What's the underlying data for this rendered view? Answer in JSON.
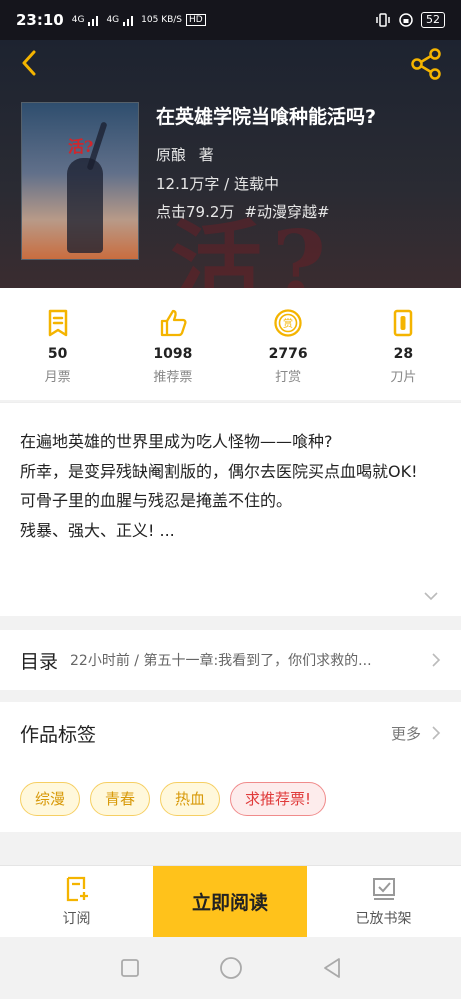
{
  "status_bar": {
    "time": "23:10",
    "signal_1": "4G",
    "signal_2": "4G",
    "net_speed": "105 KB/S",
    "hd_label": "HD",
    "battery": "52"
  },
  "book": {
    "title": "在英雄学院当喰种能活吗?",
    "cover_text": "活?",
    "header_bg_text": "活?",
    "author": "原酿",
    "author_suffix": "著",
    "stats": "12.1万字 / 连载中",
    "clicks": "点击79.2万",
    "genre_tag": "#动漫穿越#"
  },
  "metrics": [
    {
      "icon": "monthly-ticket-icon",
      "value": "50",
      "label": "月票"
    },
    {
      "icon": "thumbs-up-icon",
      "value": "1098",
      "label": "推荐票"
    },
    {
      "icon": "reward-coin-icon",
      "value": "2776",
      "label": "打赏"
    },
    {
      "icon": "blade-icon",
      "value": "28",
      "label": "刀片"
    }
  ],
  "synopsis": {
    "line1": "在遍地英雄的世界里成为吃人怪物——喰种?",
    "line2": "所幸，是变异残缺阉割版的，偶尔去医院买点血喝就OK!",
    "line3": "可骨子里的血腥与残忍是掩盖不住的。",
    "line4": "残暴、强大、正义! ..."
  },
  "toc": {
    "title": "目录",
    "latest": "22小时前 / 第五十一章:我看到了，你们求救的..."
  },
  "tags": {
    "title": "作品标签",
    "more": "更多",
    "items": [
      "综漫",
      "青春",
      "热血",
      "求推荐票!"
    ]
  },
  "bottom_bar": {
    "subscribe": "订阅",
    "read_now": "立即阅读",
    "shelf": "已放书架"
  },
  "colors": {
    "accent": "#ffc21b",
    "icon_yellow": "#f4b400",
    "tag_red": "#e03b3b"
  }
}
